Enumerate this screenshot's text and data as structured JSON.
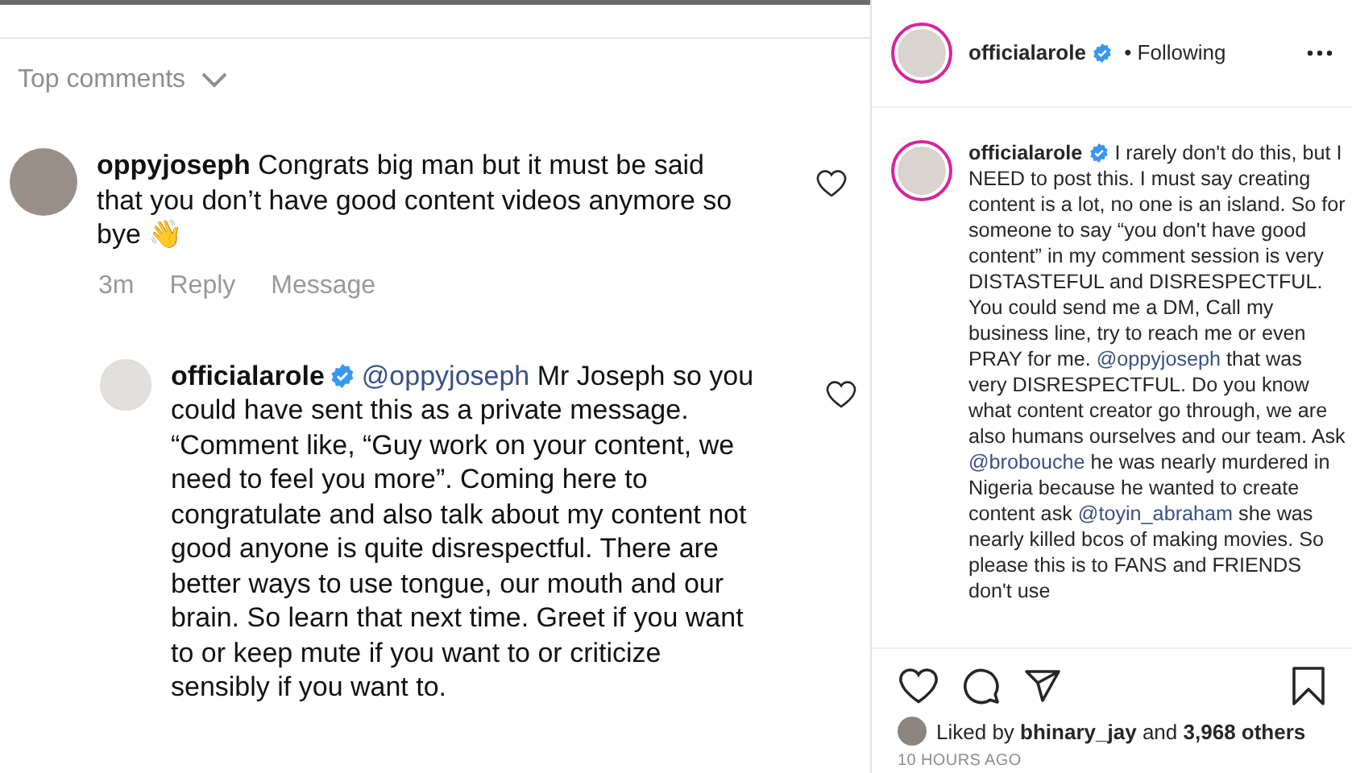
{
  "comments_screenshot": {
    "sort_label": "Top comments",
    "comment": {
      "username": "oppyjoseph",
      "text": "Congrats big man but it must be said that you don’t have good content videos anymore so bye 👋",
      "liked": false,
      "time": "3m",
      "actions": [
        "Reply",
        "Message"
      ]
    },
    "reply": {
      "username": "officialarole",
      "verified": true,
      "liked": false,
      "segments": [
        {
          "kind": "mention",
          "text": "@oppyjoseph"
        },
        {
          "kind": "text",
          "text": " Mr Joseph so you could have sent this as a private message. “Comment like, “Guy work on your content, we need to feel you more”. Coming here to congratulate and also talk about my content not good anyone is quite disrespectful. There are better ways to use tongue, our mouth and our brain. So learn that next time. Greet if you want to or keep mute if you want to or criticize sensibly if you want to."
        }
      ]
    }
  },
  "post": {
    "header": {
      "username": "officialarole",
      "verified": true,
      "separator": "•",
      "follow_status": "Following"
    },
    "caption": {
      "username": "officialarole",
      "verified": true,
      "segments": [
        {
          "kind": "text",
          "text": "I rarely don't do this, but I NEED to post this. I must say creating content is a lot, no one is an island. So for someone to say “you don't have good content” in my comment session is very DISTASTEFUL and DISRESPECTFUL. You could send me a DM, Call my business line, try to reach me or even PRAY for me. "
        },
        {
          "kind": "mention",
          "text": "@oppyjoseph"
        },
        {
          "kind": "text",
          "text": " that was very DISRESPECTFUL. Do you know what content creator go through, we are also humans ourselves and our team. Ask "
        },
        {
          "kind": "mention",
          "text": "@brobouche"
        },
        {
          "kind": "text",
          "text": " he was nearly murdered in Nigeria because he wanted to create content ask "
        },
        {
          "kind": "mention",
          "text": "@toyin_abraham"
        },
        {
          "kind": "text",
          "text": " she was nearly killed bcos of making movies. So please this is to FANS and FRIENDS don't use"
        }
      ]
    },
    "liked": false,
    "saved": false,
    "likes": {
      "prefix": "Liked by",
      "user": "bhinary_jay",
      "middle": "and",
      "count": "3,968 others"
    },
    "time": "10 HOURS AGO"
  }
}
